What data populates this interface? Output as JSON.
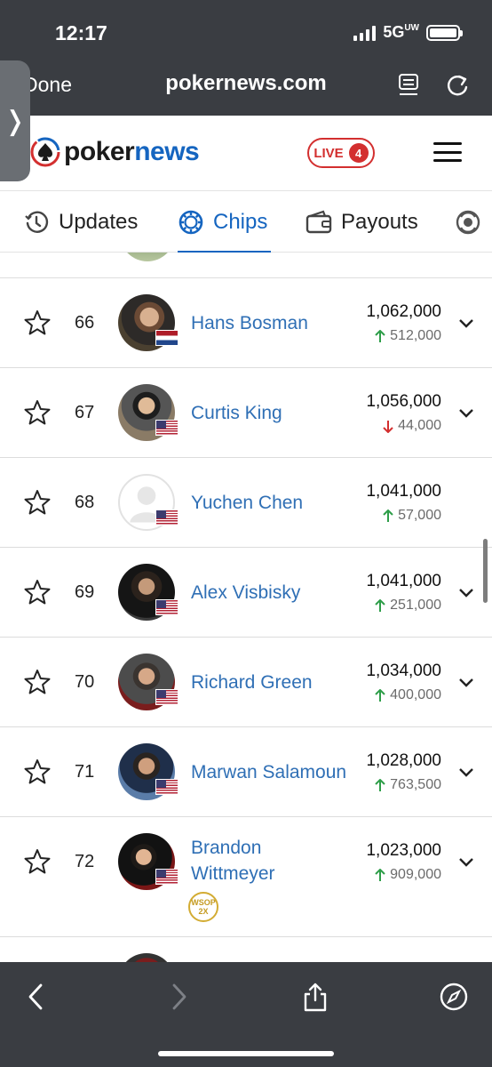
{
  "status_bar": {
    "time": "12:17",
    "network": "5G",
    "network_suffix": "UW"
  },
  "browser": {
    "done_label": "Done",
    "url": "pokernews.com",
    "icons": [
      "reader-icon",
      "reload-icon"
    ]
  },
  "header": {
    "logo_poker": "poker",
    "logo_news": "news",
    "live_label": "LIVE",
    "live_count": "4"
  },
  "tabs": [
    {
      "label": "Updates",
      "icon": "clock-icon"
    },
    {
      "label": "Chips",
      "icon": "chip-icon",
      "active": true
    },
    {
      "label": "Payouts",
      "icon": "wallet-icon"
    },
    {
      "label": "",
      "icon": "refresh-chip-icon"
    }
  ],
  "players": [
    {
      "rank": "66",
      "name": "Hans Bosman",
      "chips": "1,062,000",
      "delta": "512,000",
      "trend": "up",
      "flag": "nl"
    },
    {
      "rank": "67",
      "name": "Curtis King",
      "chips": "1,056,000",
      "delta": "44,000",
      "trend": "down",
      "flag": "us"
    },
    {
      "rank": "68",
      "name": "Yuchen Chen",
      "chips": "1,041,000",
      "delta": "57,000",
      "trend": "up",
      "flag": "us",
      "no_photo": true
    },
    {
      "rank": "69",
      "name": "Alex Visbisky",
      "chips": "1,041,000",
      "delta": "251,000",
      "trend": "up",
      "flag": "us"
    },
    {
      "rank": "70",
      "name": "Richard Green",
      "chips": "1,034,000",
      "delta": "400,000",
      "trend": "up",
      "flag": "us"
    },
    {
      "rank": "71",
      "name": "Marwan Salamoun",
      "chips": "1,028,000",
      "delta": "763,500",
      "trend": "up",
      "flag": "us"
    },
    {
      "rank": "72",
      "name_line1": "Brandon",
      "name_line2": "Wittmeyer",
      "chips": "1,023,000",
      "delta": "909,000",
      "trend": "up",
      "flag": "us",
      "badge_top": "WSOP",
      "badge_bottom": "2X"
    }
  ],
  "colors": {
    "accent": "#1565c0",
    "up": "#2e9e49",
    "down": "#d32f2f",
    "live": "#d32f2f",
    "chrome": "#3a3d42"
  }
}
